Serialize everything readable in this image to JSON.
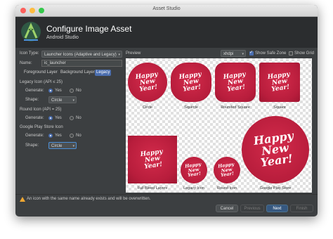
{
  "window": {
    "title": "Asset Studio"
  },
  "header": {
    "title": "Configure Image Asset",
    "subtitle": "Android Studio"
  },
  "form": {
    "icon_type_label": "Icon Type:",
    "icon_type_value": "Launcher Icons (Adaptive and Legacy)",
    "name_label": "Name:",
    "name_value": "ic_launcher",
    "tabs": [
      "Foreground Layer",
      "Background Layer",
      "Legacy"
    ],
    "active_tab": "Legacy",
    "legacy_section": "Legacy Icon (API ≤ 25)",
    "legacy_generate_label": "Generate:",
    "legacy_shape_label": "Shape:",
    "legacy_shape_value": "Circle",
    "round_section": "Round Icon (API = 25)",
    "round_generate_label": "Generate:",
    "play_section": "Google Play Store Icon",
    "play_generate_label": "Generate:",
    "play_shape_label": "Shape:",
    "play_shape_value": "Circle",
    "yes": "Yes",
    "no": "No"
  },
  "preview": {
    "label": "Preview",
    "density": "xhdpi",
    "show_safe_zone": "Show Safe Zone",
    "show_safe_zone_checked": true,
    "show_grid": "Show Grid",
    "show_grid_checked": false,
    "icon_text": [
      "Happy",
      "New",
      "Year!"
    ],
    "icon_color": "#c0213f",
    "icons": [
      {
        "caption": "Circle"
      },
      {
        "caption": "Squircle"
      },
      {
        "caption": "Rounded Square"
      },
      {
        "caption": "Square"
      },
      {
        "caption": "Full Bleed Layers"
      },
      {
        "caption": "Legacy Icon"
      },
      {
        "caption": "Round Icon"
      },
      {
        "caption": "Google Play Store"
      }
    ]
  },
  "warning": "An icon with the same name already exists and will be overwritten.",
  "buttons": {
    "cancel": "Cancel",
    "previous": "Previous",
    "next": "Next",
    "finish": "Finish"
  }
}
